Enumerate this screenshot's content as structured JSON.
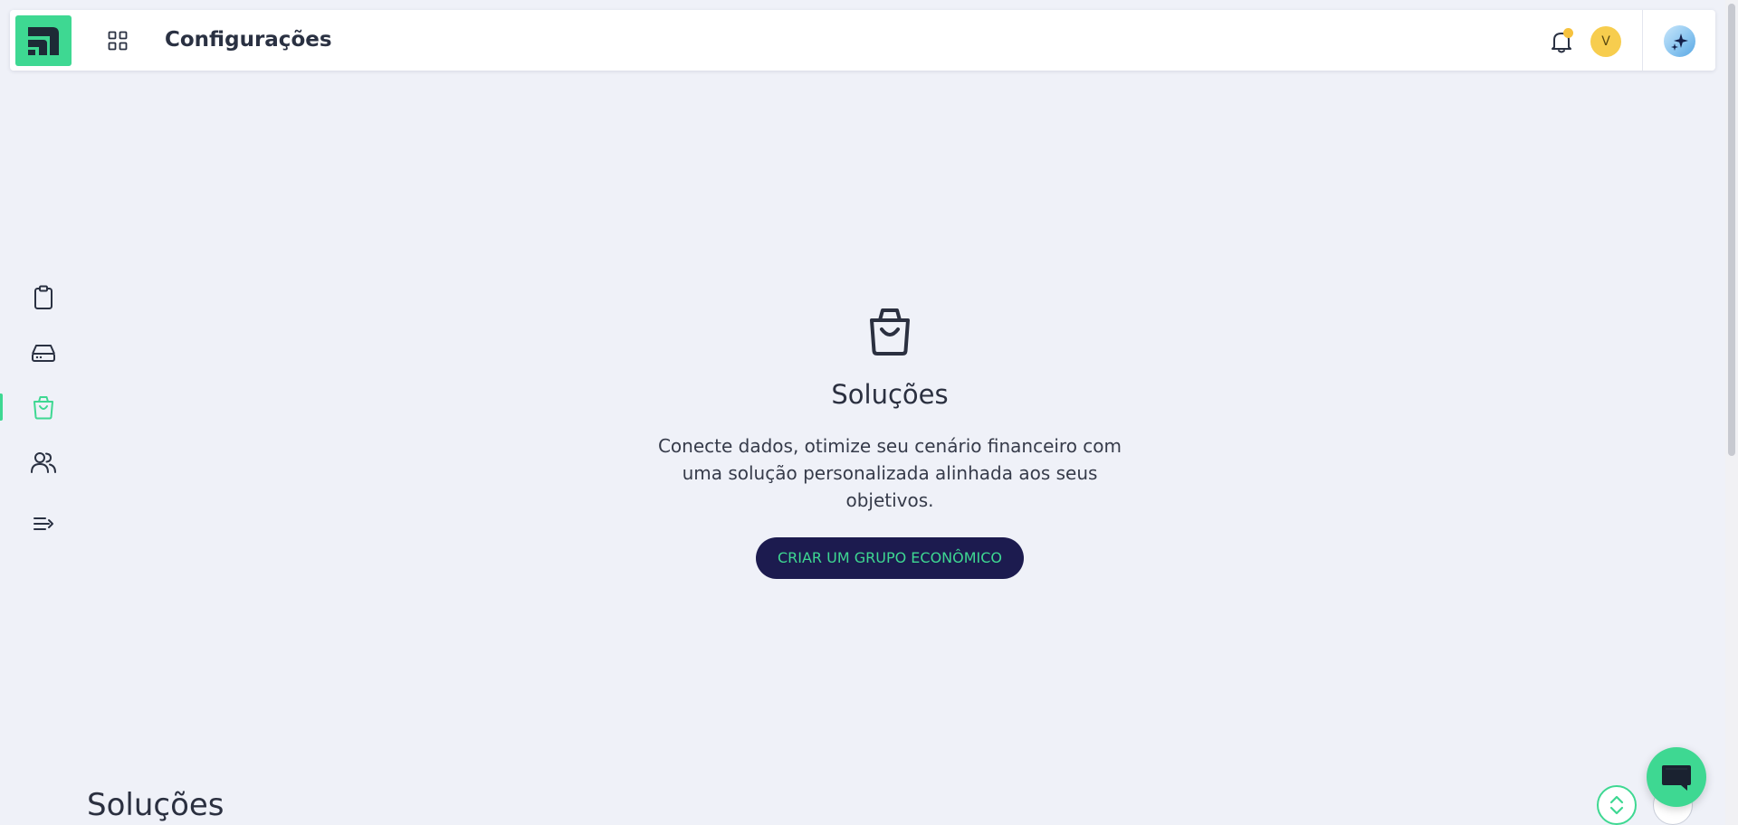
{
  "header": {
    "title": "Configurações",
    "avatar_initial": "V",
    "notification_badge": true
  },
  "sidebar": {
    "items": [
      {
        "id": "clipboard",
        "icon": "clipboard-icon",
        "active": false
      },
      {
        "id": "storage",
        "icon": "hard-drive-icon",
        "active": false
      },
      {
        "id": "solutions",
        "icon": "shopping-bag-icon",
        "active": true
      },
      {
        "id": "users",
        "icon": "users-icon",
        "active": false
      },
      {
        "id": "expand",
        "icon": "collapse-menu-icon",
        "active": false
      }
    ]
  },
  "empty_state": {
    "icon": "shopping-bag-icon",
    "title": "Soluções",
    "description": "Conecte dados, otimize seu cenário financeiro com uma solução personalizada alinhada aos seus objetivos.",
    "button_label": "CRIAR UM GRUPO ECONÔMICO"
  },
  "section": {
    "title": "Soluções"
  },
  "colors": {
    "accent": "#3ed892",
    "primary_dark": "#1c1b4f",
    "background": "#eff1f8",
    "badge": "#f6c23e",
    "avatar": "#f7cd4e"
  }
}
